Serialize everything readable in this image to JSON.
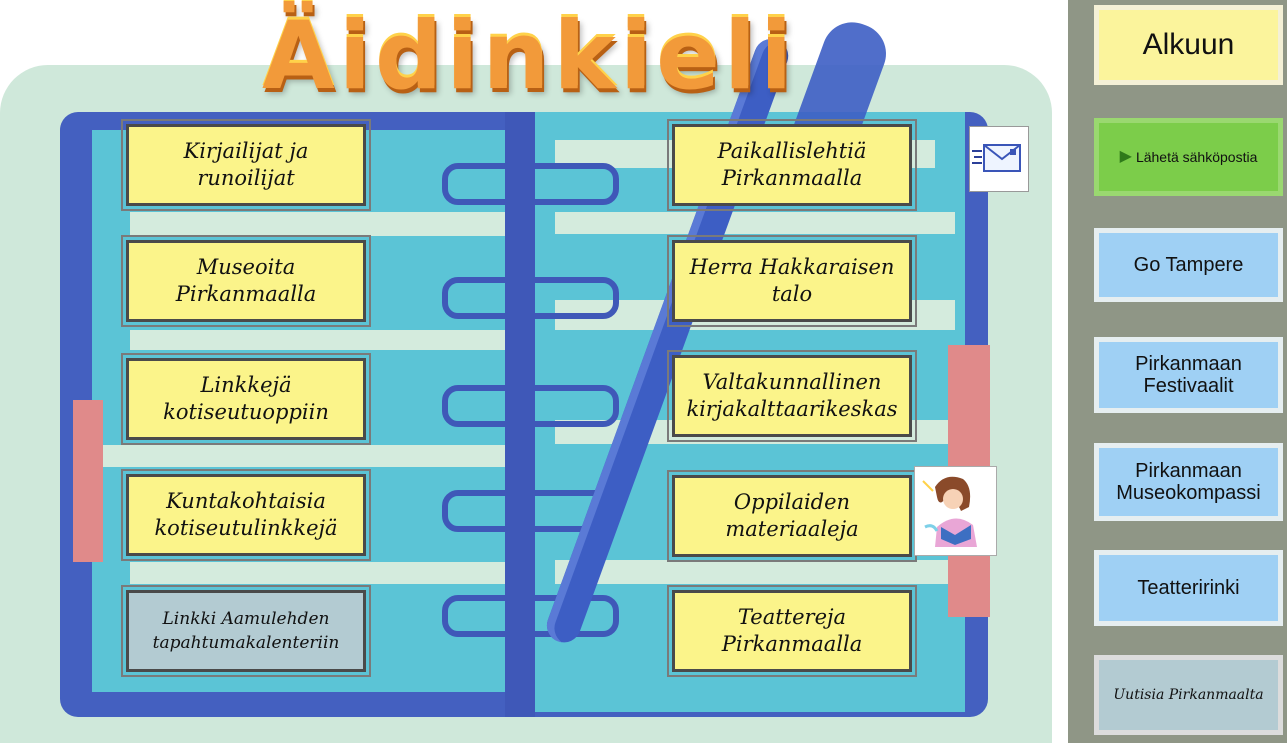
{
  "title": "Äidinkieli",
  "left_links": [
    {
      "label_1": "Kirjailijat ja",
      "label_2": "runoilijat"
    },
    {
      "label_1": "Museoita",
      "label_2": "Pirkanmaalla"
    },
    {
      "label_1": "Linkkejä",
      "label_2": "kotiseutuoppiin"
    },
    {
      "label_1": "Kuntakohtaisia",
      "label_2": "kotiseutulinkkejä"
    },
    {
      "label_1": "Linkki Aamulehden",
      "label_2": "tapahtumakalenteriin"
    }
  ],
  "right_links": [
    {
      "label_1": "Paikallislehtiä",
      "label_2": "Pirkanmaalla"
    },
    {
      "label_1": "Herra Hakkaraisen",
      "label_2": "talo"
    },
    {
      "label_1": "Valtakunnallinen",
      "label_2": "kirjakalttaarikeskas"
    },
    {
      "label_1": "Oppilaiden",
      "label_2": "materiaaleja"
    },
    {
      "label_1": "Teattereja",
      "label_2": "Pirkanmaalla"
    }
  ],
  "sidebar": {
    "home": "Alkuun",
    "mail": "Lähetä sähköpostia",
    "go_tampere": "Go Tampere",
    "festivals_1": "Pirkanmaan",
    "festivals_2": "Festivaalit",
    "museum_1": "Pirkanmaan",
    "museum_2": "Museokompassi",
    "theatre": "Teatteririnki",
    "news": "Uutisia Pirkanmaalta"
  },
  "icons": {
    "mail": "envelope-icon",
    "kid": "girl-reading-icon"
  },
  "colors": {
    "link_box": "#fbf48a",
    "binder_blue": "#4460c0",
    "cover_cyan": "#5bc4d6",
    "sidebar_bg": "#8f9686",
    "mail_button": "#7ccd4a",
    "blue_button": "#9fd0f4"
  }
}
